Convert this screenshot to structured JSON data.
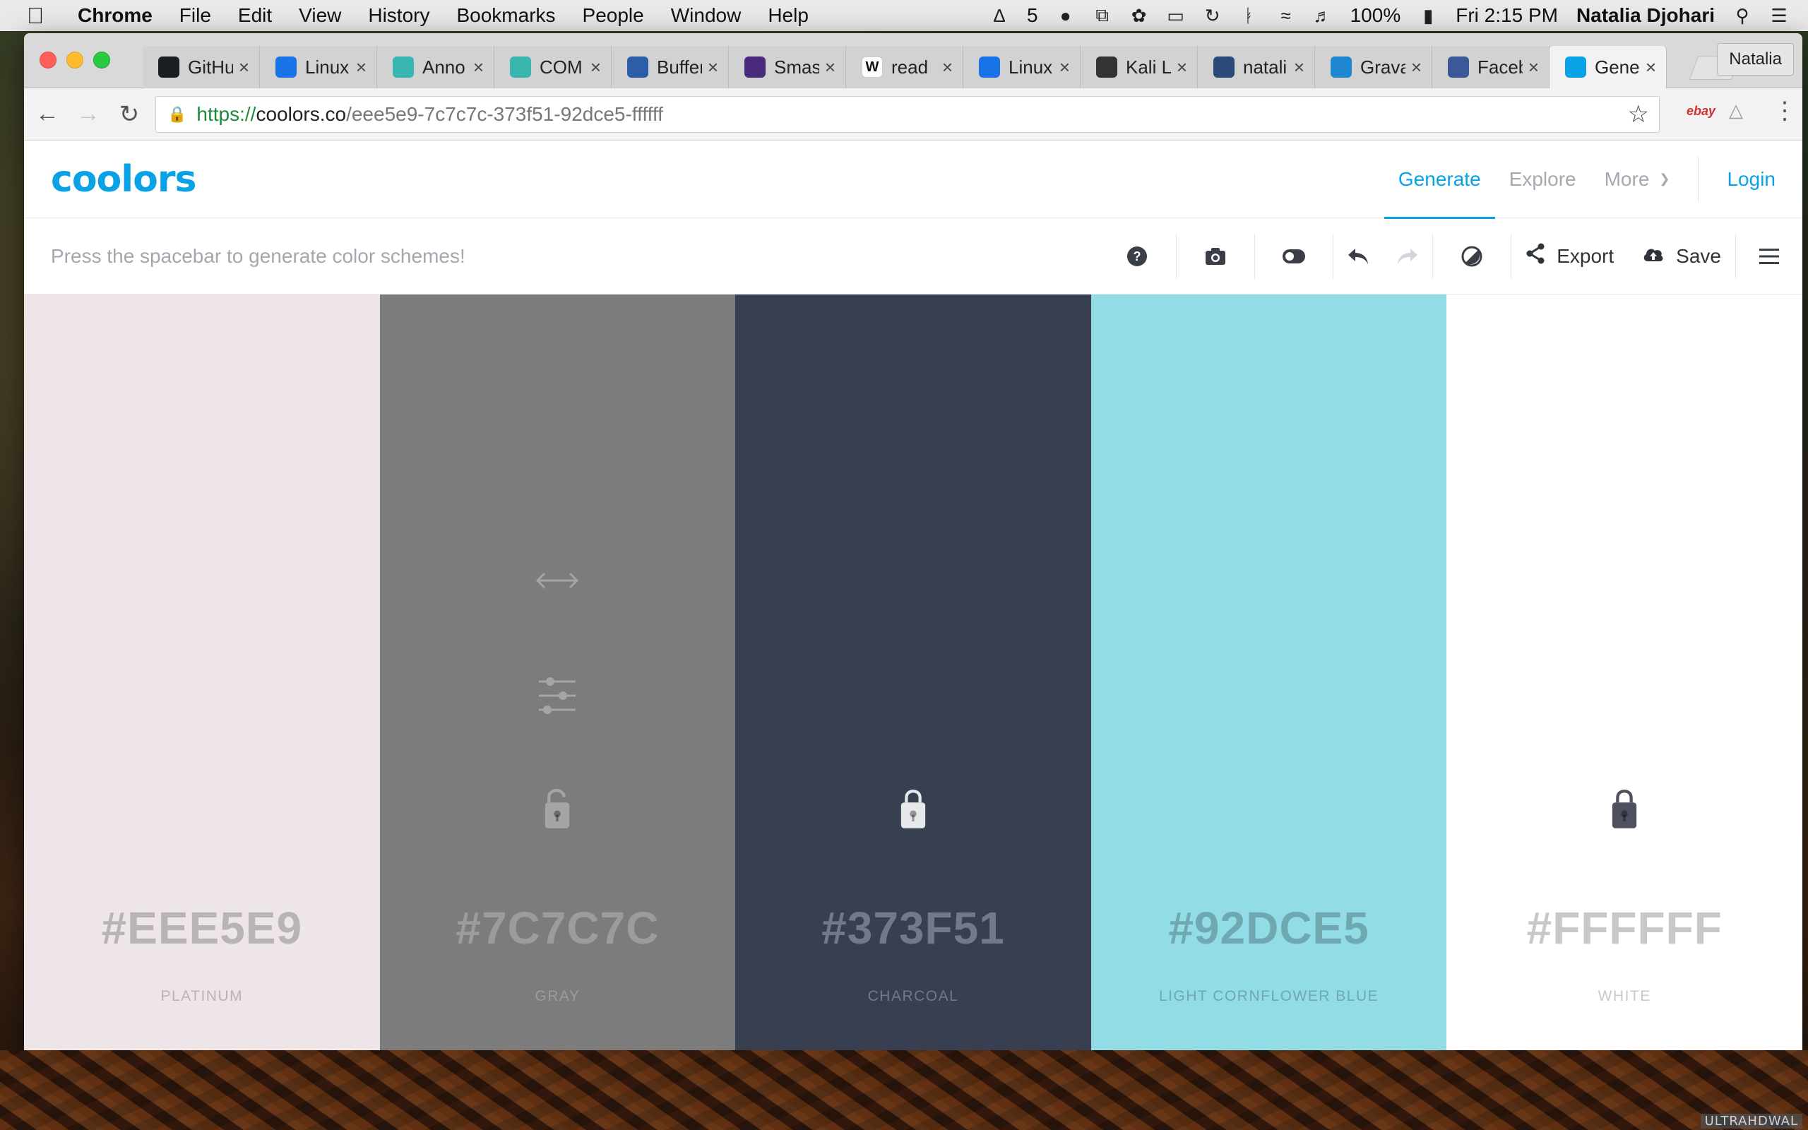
{
  "menubar": {
    "app": "Chrome",
    "items": [
      "File",
      "Edit",
      "View",
      "History",
      "Bookmarks",
      "People",
      "Window",
      "Help"
    ],
    "status": {
      "adobe_count": "5",
      "battery": "100%",
      "clock": "Fri 2:15 PM",
      "user": "Natalia Djohari"
    }
  },
  "browser": {
    "tabs": [
      {
        "title": "GitHub",
        "favicon_color": "#1b1f23",
        "icon": "github-icon"
      },
      {
        "title": "Linux",
        "favicon_color": "#1b73e8",
        "icon": "linux-icon"
      },
      {
        "title": "Anno",
        "favicon_color": "#3ab6b0",
        "icon": "anno-icon"
      },
      {
        "title": "COM",
        "favicon_color": "#3ab6b0",
        "icon": "com-icon"
      },
      {
        "title": "Buffer",
        "favicon_color": "#2b5da8",
        "icon": "buffer-icon"
      },
      {
        "title": "Smas",
        "favicon_color": "#4a2a7a",
        "icon": "eye-icon"
      },
      {
        "title": "read",
        "favicon_color": "#ffffff",
        "icon": "wikipedia-icon"
      },
      {
        "title": "Linux",
        "favicon_color": "#1b73e8",
        "icon": "linux-icon"
      },
      {
        "title": "Kali L",
        "favicon_color": "#333333",
        "icon": "kali-icon"
      },
      {
        "title": "natali",
        "favicon_color": "#2b4a7a",
        "icon": "bucket-icon"
      },
      {
        "title": "Grava",
        "favicon_color": "#1e87d0",
        "icon": "gravatar-icon"
      },
      {
        "title": "Faceb",
        "favicon_color": "#3b5998",
        "icon": "facebook-icon"
      },
      {
        "title": "Gene",
        "favicon_color": "#0aa2e6",
        "icon": "coolors-icon"
      }
    ],
    "profile": "Natalia",
    "url": {
      "scheme": "https://",
      "host": "coolors.co",
      "path": "/eee5e9-7c7c7c-373f51-92dce5-ffffff"
    },
    "extensions": {
      "ebay": "ebay"
    }
  },
  "site": {
    "logo": "coolors",
    "nav": {
      "generate": "Generate",
      "explore": "Explore",
      "more": "More",
      "login": "Login"
    },
    "hint": "Press the spacebar to generate color schemes!",
    "tools": {
      "export": "Export",
      "save": "Save"
    },
    "accent": "#0aa2e6"
  },
  "palette": [
    {
      "hex": "#EEE5E9",
      "name": "PLATINUM",
      "bg": "#eee5e9",
      "text": "#b8b3b6",
      "icon": "#c7bfc3",
      "show_controls": false,
      "locked": false
    },
    {
      "hex": "#7C7C7C",
      "name": "GRAY",
      "bg": "#7c7c7c",
      "text": "#9c9c9c",
      "icon": "#a5a5a5",
      "show_controls": true,
      "locked": false
    },
    {
      "hex": "#373F51",
      "name": "CHARCOAL",
      "bg": "#373f51",
      "text": "#727988",
      "icon": "#e6e8ec",
      "show_controls": false,
      "locked": true
    },
    {
      "hex": "#92DCE5",
      "name": "LIGHT CORNFLOWER BLUE",
      "bg": "#92dce5",
      "text": "#6fa8b0",
      "icon": "#6fa8b0",
      "show_controls": false,
      "locked": false
    },
    {
      "hex": "#FFFFFF",
      "name": "WHITE",
      "bg": "#ffffff",
      "text": "#c8c8c8",
      "icon": "#4e5160",
      "show_controls": false,
      "locked": true
    }
  ],
  "watermark": "ULTRAHDWAL"
}
